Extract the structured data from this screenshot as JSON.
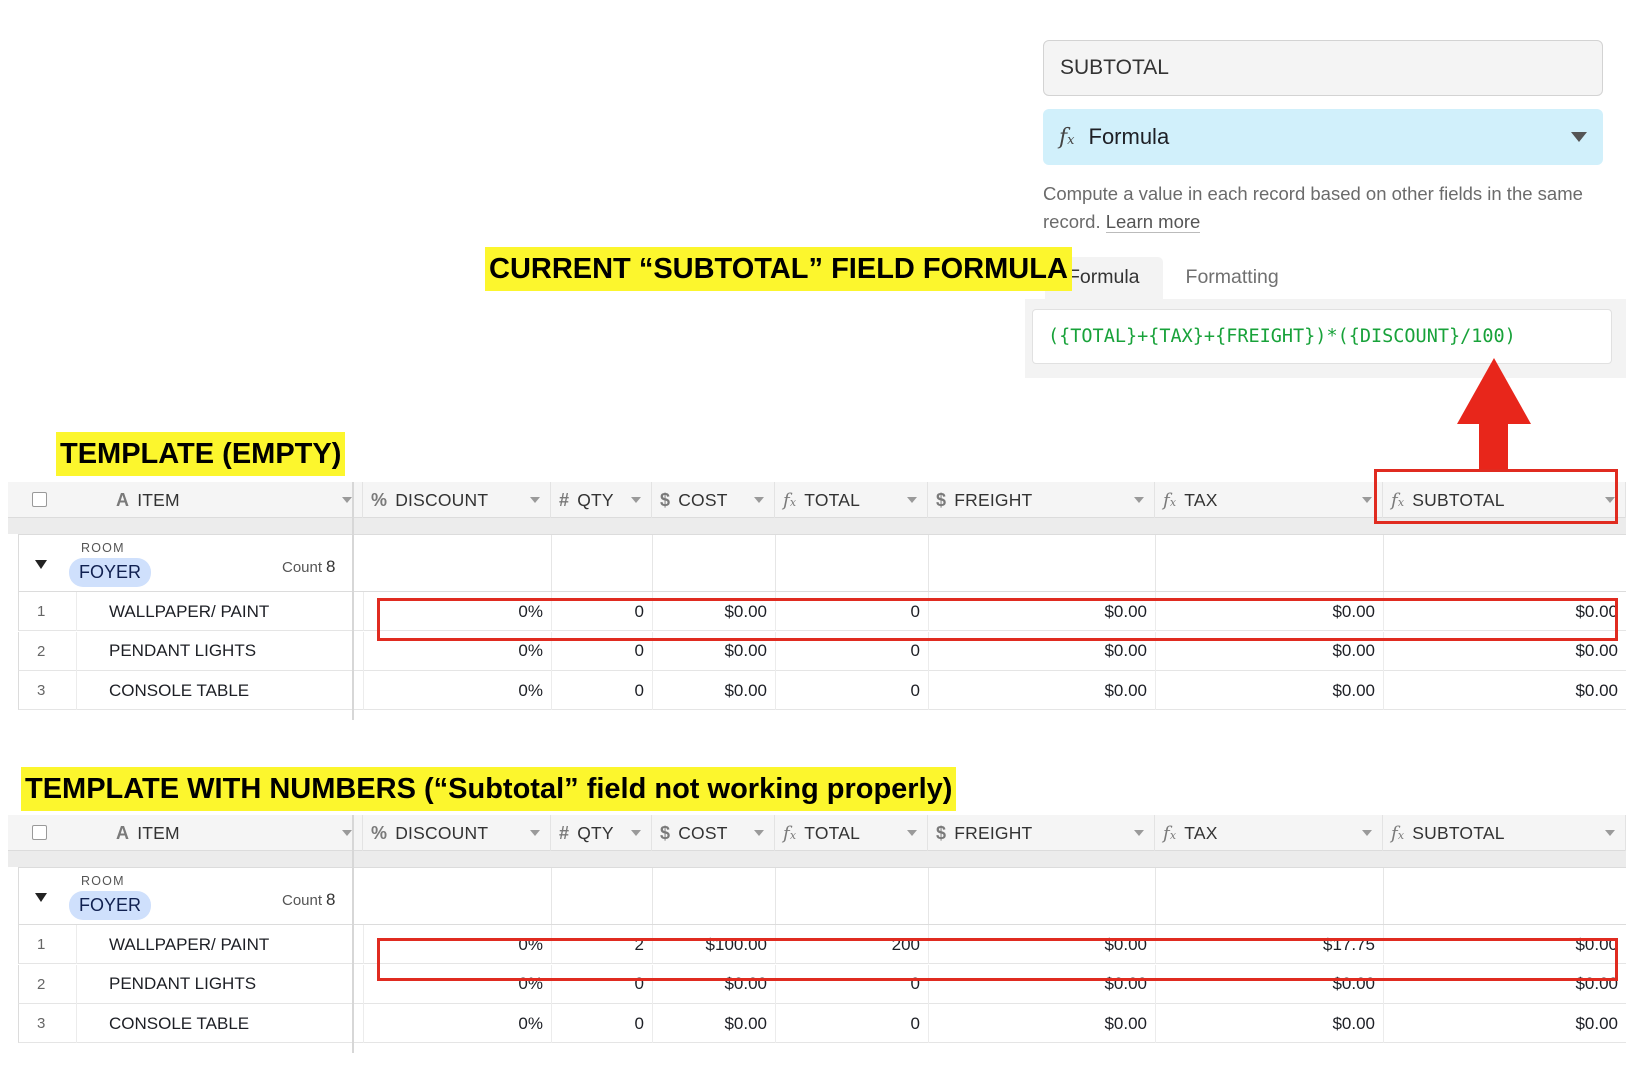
{
  "field_panel": {
    "name_value": "SUBTOTAL",
    "type_icon": "fx-formula-icon",
    "type_label": "Formula",
    "description": "Compute a value in each record based on other fields in the same record.",
    "learn_more": "Learn more",
    "tabs": [
      "Formula",
      "Formatting"
    ],
    "active_tab": "Formula",
    "formula": "({TOTAL}+{TAX}+{FREIGHT})*({DISCOUNT}/100)"
  },
  "captions": {
    "formula_caption": "CURRENT “SUBTOTAL” FIELD FORMULA",
    "empty_caption": "TEMPLATE (EMPTY)",
    "numbers_caption": "TEMPLATE WITH NUMBERS (“Subtotal” field not working properly)"
  },
  "columns": [
    {
      "label": "ITEM",
      "icon": "A"
    },
    {
      "label": "DISCOUNT",
      "icon": "%"
    },
    {
      "label": "QTY",
      "icon": "#"
    },
    {
      "label": "COST",
      "icon": "$"
    },
    {
      "label": "TOTAL",
      "icon": "fx"
    },
    {
      "label": "FREIGHT",
      "icon": "$"
    },
    {
      "label": "TAX",
      "icon": "fx"
    },
    {
      "label": "SUBTOTAL",
      "icon": "fx"
    }
  ],
  "colors": {
    "highlight": "#fcf62d",
    "alert_red": "#e02b20",
    "formula_green": "#18a23a",
    "type_select_bg": "#d1f0fb",
    "group_pill": "#cfe0fc"
  },
  "grid_empty": {
    "group_label": "ROOM",
    "group_value": "FOYER",
    "count_label": "Count",
    "count_value": "8",
    "rows": [
      {
        "index": "1",
        "item": "WALLPAPER/ PAINT",
        "discount": "0%",
        "qty": "0",
        "cost": "$0.00",
        "total": "0",
        "freight": "$0.00",
        "tax": "$0.00",
        "subtotal": "$0.00"
      },
      {
        "index": "2",
        "item": "PENDANT LIGHTS",
        "discount": "0%",
        "qty": "0",
        "cost": "$0.00",
        "total": "0",
        "freight": "$0.00",
        "tax": "$0.00",
        "subtotal": "$0.00"
      },
      {
        "index": "3",
        "item": "CONSOLE TABLE",
        "discount": "0%",
        "qty": "0",
        "cost": "$0.00",
        "total": "0",
        "freight": "$0.00",
        "tax": "$0.00",
        "subtotal": "$0.00"
      }
    ]
  },
  "grid_numbers": {
    "group_label": "ROOM",
    "group_value": "FOYER",
    "count_label": "Count",
    "count_value": "8",
    "rows": [
      {
        "index": "1",
        "item": "WALLPAPER/ PAINT",
        "discount": "0%",
        "qty": "2",
        "cost": "$100.00",
        "total": "200",
        "freight": "$0.00",
        "tax": "$17.75",
        "subtotal": "$0.00"
      },
      {
        "index": "2",
        "item": "PENDANT LIGHTS",
        "discount": "0%",
        "qty": "0",
        "cost": "$0.00",
        "total": "0",
        "freight": "$0.00",
        "tax": "$0.00",
        "subtotal": "$0.00"
      },
      {
        "index": "3",
        "item": "CONSOLE TABLE",
        "discount": "0%",
        "qty": "0",
        "cost": "$0.00",
        "total": "0",
        "freight": "$0.00",
        "tax": "$0.00",
        "subtotal": "$0.00"
      }
    ]
  }
}
